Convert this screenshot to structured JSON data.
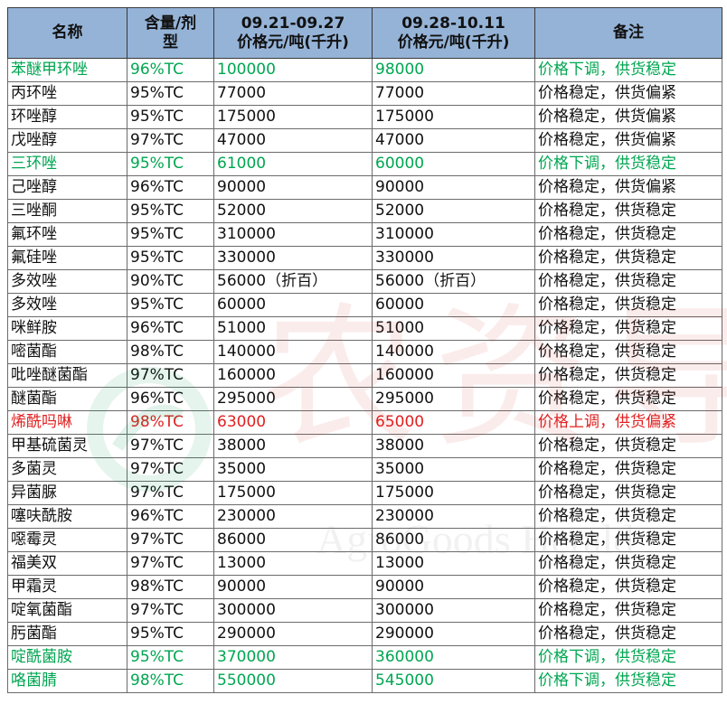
{
  "header": {
    "name": "名称",
    "spec_line1": "含量/剂",
    "spec_line2": "型",
    "period1_dates": "09.21-09.27",
    "period1_unit": "价格元/吨(千升)",
    "period2_dates": "09.28-10.11",
    "period2_unit": "价格元/吨(千升)",
    "note": "备注"
  },
  "rows": [
    {
      "name": "苯醚甲环唑",
      "spec": "96%TC",
      "p1": "100000",
      "p2": "98000",
      "note": "价格下调，供货稳定",
      "trend": "down"
    },
    {
      "name": "丙环唑",
      "spec": "95%TC",
      "p1": "77000",
      "p2": "77000",
      "note": "价格稳定，供货偏紧",
      "trend": "flat"
    },
    {
      "name": "环唑醇",
      "spec": "95%TC",
      "p1": "175000",
      "p2": "175000",
      "note": "价格稳定，供货偏紧",
      "trend": "flat"
    },
    {
      "name": "戊唑醇",
      "spec": "97%TC",
      "p1": "47000",
      "p2": "47000",
      "note": "价格稳定，供货偏紧",
      "trend": "flat"
    },
    {
      "name": "三环唑",
      "spec": "95%TC",
      "p1": "61000",
      "p2": "60000",
      "note": "价格下调，供货稳定",
      "trend": "down"
    },
    {
      "name": "己唑醇",
      "spec": "96%TC",
      "p1": "90000",
      "p2": "90000",
      "note": "价格稳定，供货偏紧",
      "trend": "flat"
    },
    {
      "name": "三唑酮",
      "spec": "95%TC",
      "p1": "52000",
      "p2": "52000",
      "note": "价格稳定，供货稳定",
      "trend": "flat"
    },
    {
      "name": "氟环唑",
      "spec": "95%TC",
      "p1": "310000",
      "p2": "310000",
      "note": "价格稳定，供货稳定",
      "trend": "flat"
    },
    {
      "name": "氟硅唑",
      "spec": "95%TC",
      "p1": "330000",
      "p2": "330000",
      "note": "价格稳定，供货稳定",
      "trend": "flat"
    },
    {
      "name": "多效唑",
      "spec": "90%TC",
      "p1": "56000（折百）",
      "p2": "56000（折百）",
      "note": "价格稳定，供货稳定",
      "trend": "flat"
    },
    {
      "name": "多效唑",
      "spec": "95%TC",
      "p1": "60000",
      "p2": "60000",
      "note": "价格稳定，供货稳定",
      "trend": "flat"
    },
    {
      "name": "咪鲜胺",
      "spec": "96%TC",
      "p1": "51000",
      "p2": "51000",
      "note": "价格稳定，供货稳定",
      "trend": "flat"
    },
    {
      "name": "嘧菌酯",
      "spec": "98%TC",
      "p1": "140000",
      "p2": "140000",
      "note": "价格稳定，供货稳定",
      "trend": "flat"
    },
    {
      "name": "吡唑醚菌酯",
      "spec": "97%TC",
      "p1": "160000",
      "p2": "160000",
      "note": "价格稳定，供货稳定",
      "trend": "flat"
    },
    {
      "name": "醚菌酯",
      "spec": "96%TC",
      "p1": "295000",
      "p2": "295000",
      "note": "价格稳定，供货稳定",
      "trend": "flat"
    },
    {
      "name": "烯酰吗啉",
      "spec": "98%TC",
      "p1": "63000",
      "p2": "65000",
      "note": "价格上调，供货偏紧",
      "trend": "up"
    },
    {
      "name": "甲基硫菌灵",
      "spec": "97%TC",
      "p1": "38000",
      "p2": "38000",
      "note": "价格稳定，供货稳定",
      "trend": "flat"
    },
    {
      "name": "多菌灵",
      "spec": "97%TC",
      "p1": "35000",
      "p2": "35000",
      "note": "价格稳定，供货稳定",
      "trend": "flat"
    },
    {
      "name": "异菌脲",
      "spec": "97%TC",
      "p1": "175000",
      "p2": "175000",
      "note": "价格稳定，供货稳定",
      "trend": "flat"
    },
    {
      "name": "噻呋酰胺",
      "spec": "96%TC",
      "p1": "230000",
      "p2": "230000",
      "note": "价格稳定，供货稳定",
      "trend": "flat"
    },
    {
      "name": "噁霉灵",
      "spec": "97%TC",
      "p1": "86000",
      "p2": "86000",
      "note": "价格稳定，供货稳定",
      "trend": "flat"
    },
    {
      "name": "福美双",
      "spec": "97%TC",
      "p1": "13000",
      "p2": "13000",
      "note": "价格稳定，供货稳定",
      "trend": "flat"
    },
    {
      "name": "甲霜灵",
      "spec": "98%TC",
      "p1": "90000",
      "p2": "90000",
      "note": "价格稳定，供货稳定",
      "trend": "flat"
    },
    {
      "name": "啶氧菌酯",
      "spec": "97%TC",
      "p1": "300000",
      "p2": "300000",
      "note": "价格稳定，供货稳定",
      "trend": "flat"
    },
    {
      "name": "肟菌酯",
      "spec": "95%TC",
      "p1": "290000",
      "p2": "290000",
      "note": "价格稳定，供货稳定",
      "trend": "flat"
    },
    {
      "name": "啶酰菌胺",
      "spec": "95%TC",
      "p1": "370000",
      "p2": "360000",
      "note": "价格下调，供货稳定",
      "trend": "down"
    },
    {
      "name": "咯菌腈",
      "spec": "98%TC",
      "p1": "550000",
      "p2": "545000",
      "note": "价格下调，供货稳定",
      "trend": "down"
    }
  ],
  "colors": {
    "header_bg": "#95b3d7",
    "price_down": "#00a651",
    "price_up": "#e02020",
    "text": "#111111"
  },
  "watermark": {
    "cn": "农资导报",
    "en": "AgroGoods Herald"
  }
}
